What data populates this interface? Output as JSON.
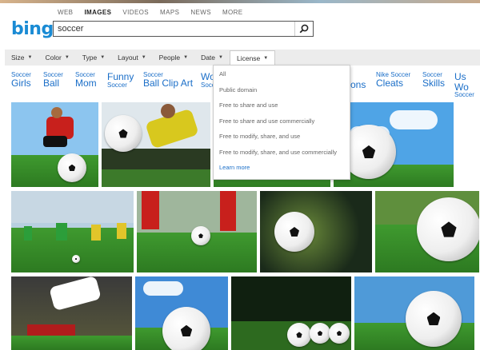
{
  "logo": "bing",
  "scopes": [
    "WEB",
    "IMAGES",
    "VIDEOS",
    "MAPS",
    "NEWS",
    "MORE"
  ],
  "search": {
    "value": "soccer"
  },
  "filters": [
    "Size",
    "Color",
    "Type",
    "Layout",
    "People",
    "Date",
    "License"
  ],
  "related": [
    {
      "small": "Soccer",
      "big": "Girls"
    },
    {
      "small": "Soccer",
      "big": "Ball"
    },
    {
      "small": "Soccer",
      "big": "Mom"
    },
    {
      "big": "Funny",
      "small": "Soccer"
    },
    {
      "small": "Soccer",
      "big": "Ball Clip Art"
    },
    {
      "big": "Wo",
      "small": "Socc"
    },
    {
      "big": "ons",
      "small": ""
    },
    {
      "small": "Nike Soccer",
      "big": "Cleats"
    },
    {
      "small": "Soccer",
      "big": "Skills"
    },
    {
      "big": "Us Wo",
      "small": "Soccer"
    }
  ],
  "license_menu": [
    "All",
    "Public domain",
    "Free to share and use",
    "Free to share and use commercially",
    "Free to modify, share, and use",
    "Free to modify, share, and use commercially",
    "Learn more"
  ]
}
